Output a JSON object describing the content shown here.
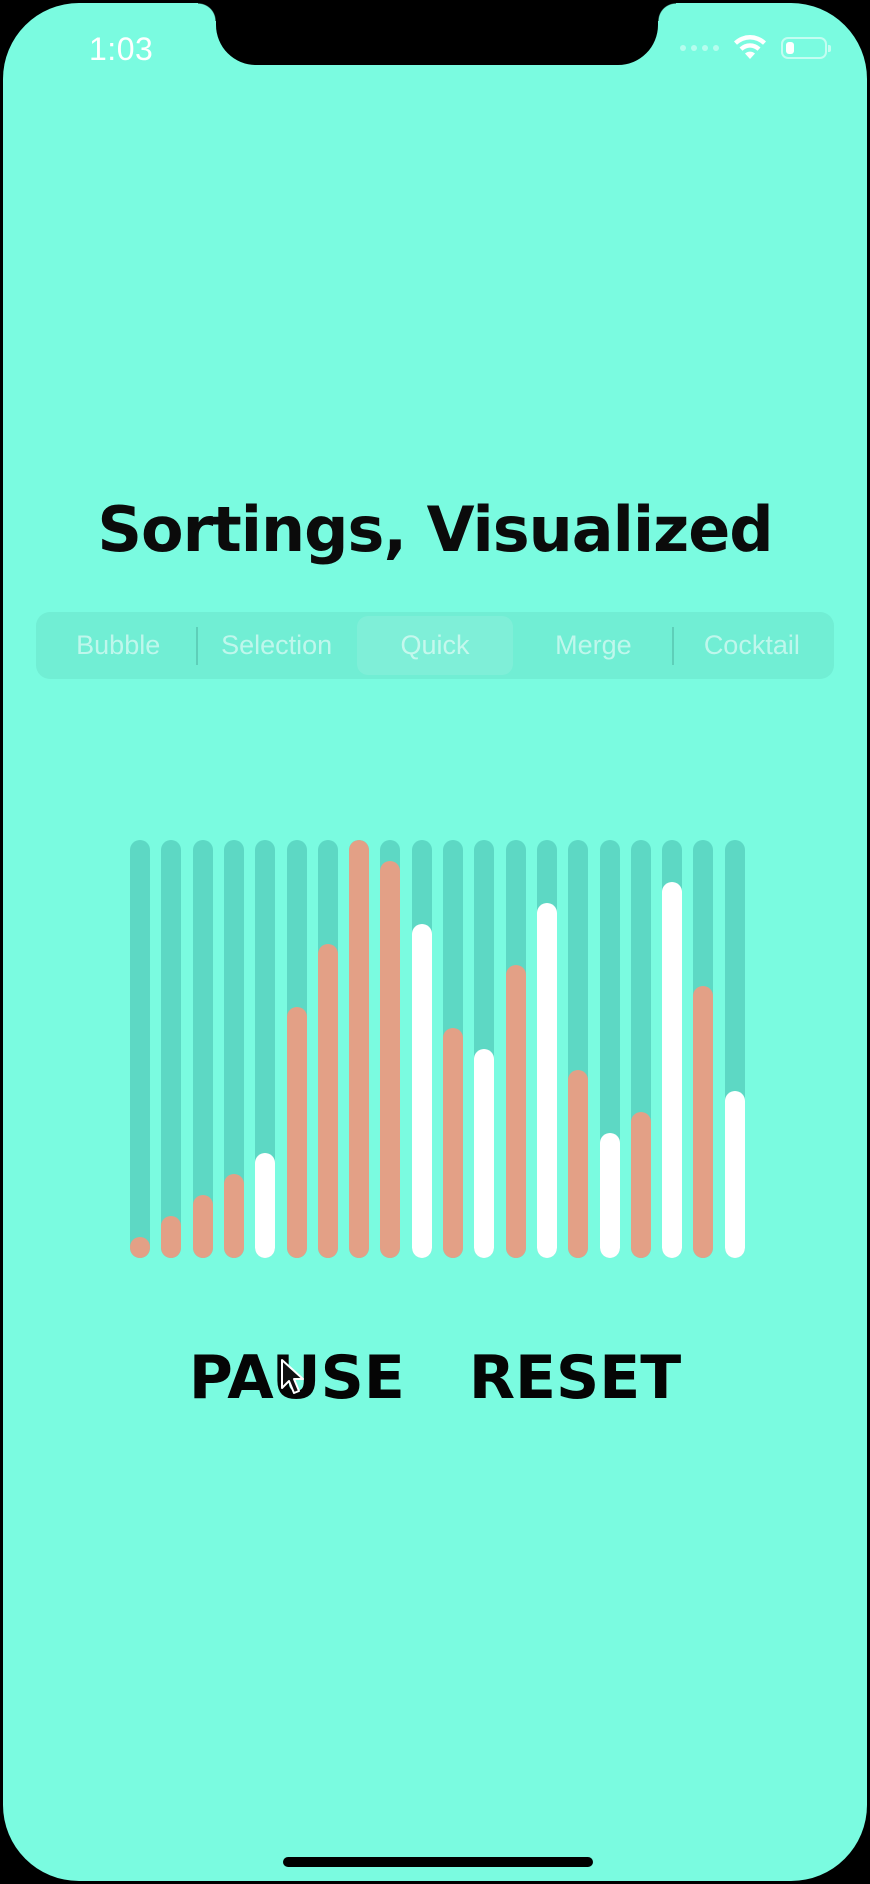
{
  "status_bar": {
    "time": "1:03"
  },
  "title": "Sortings, Visualized",
  "segments": [
    {
      "label": "Bubble",
      "selected": false
    },
    {
      "label": "Selection",
      "selected": false
    },
    {
      "label": "Quick",
      "selected": true
    },
    {
      "label": "Merge",
      "selected": false
    },
    {
      "label": "Cocktail",
      "selected": false
    }
  ],
  "battery_level": 0.2,
  "colors": {
    "background": "#7afbe0",
    "bar_track": "#5dd8c4",
    "bar_active": "#e3a086",
    "bar_sorted": "#ffffff"
  },
  "bars": [
    {
      "value": 0.05,
      "state": "active"
    },
    {
      "value": 0.1,
      "state": "active"
    },
    {
      "value": 0.15,
      "state": "active"
    },
    {
      "value": 0.2,
      "state": "active"
    },
    {
      "value": 0.25,
      "state": "sorted"
    },
    {
      "value": 0.6,
      "state": "active"
    },
    {
      "value": 0.75,
      "state": "active"
    },
    {
      "value": 1.0,
      "state": "active"
    },
    {
      "value": 0.95,
      "state": "active"
    },
    {
      "value": 0.8,
      "state": "sorted"
    },
    {
      "value": 0.55,
      "state": "active"
    },
    {
      "value": 0.5,
      "state": "sorted"
    },
    {
      "value": 0.7,
      "state": "active"
    },
    {
      "value": 0.85,
      "state": "sorted"
    },
    {
      "value": 0.45,
      "state": "active"
    },
    {
      "value": 0.3,
      "state": "sorted"
    },
    {
      "value": 0.35,
      "state": "active"
    },
    {
      "value": 0.9,
      "state": "sorted"
    },
    {
      "value": 0.65,
      "state": "active"
    },
    {
      "value": 0.4,
      "state": "sorted"
    }
  ],
  "controls": {
    "pause_label": "PAUSE",
    "reset_label": "RESET"
  }
}
